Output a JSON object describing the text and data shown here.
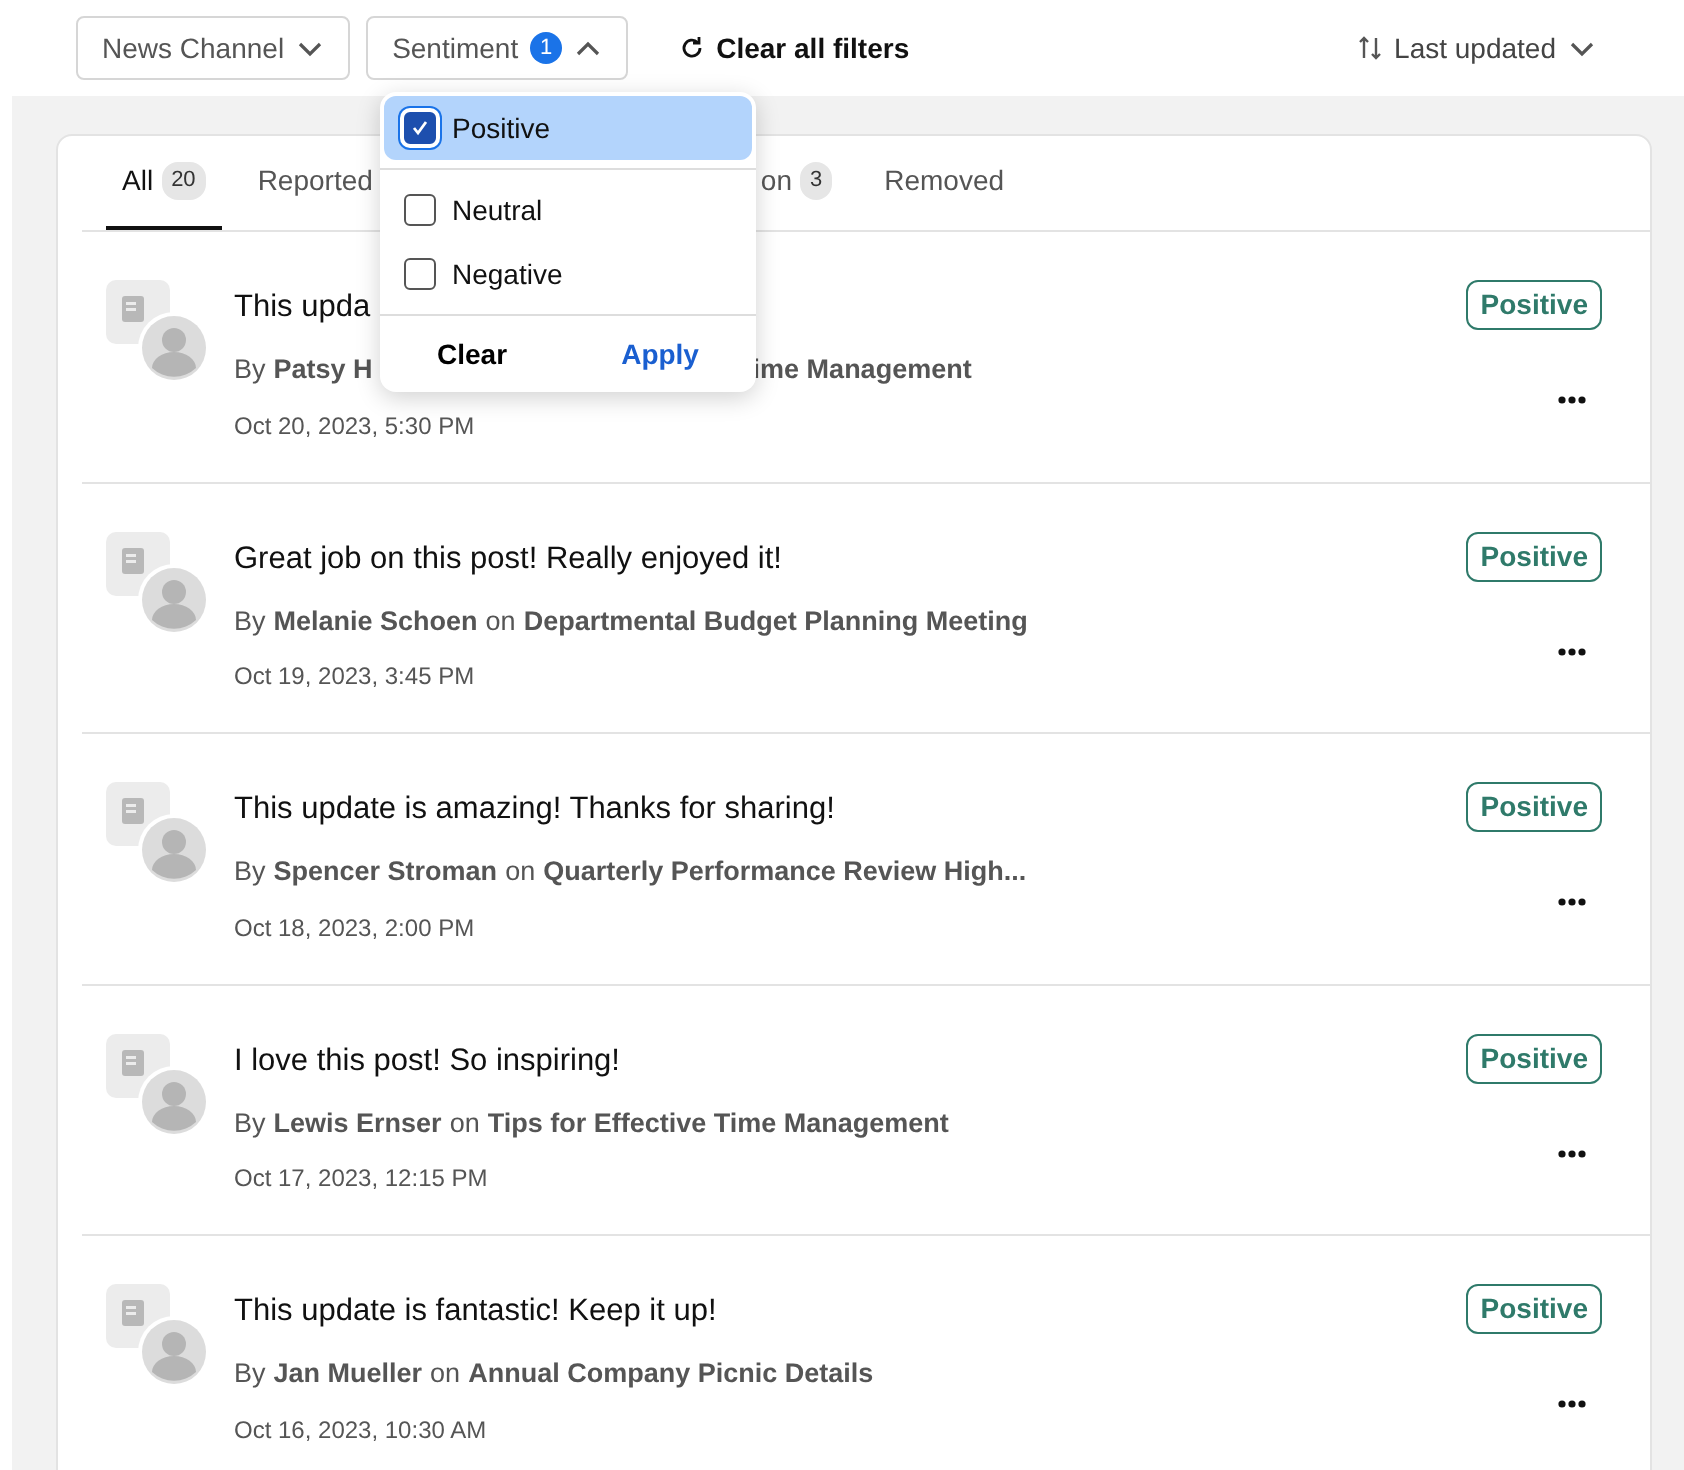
{
  "filters": [
    {
      "label": "News Channel",
      "expanded": false
    },
    {
      "label": "Sentiment",
      "count": "1",
      "expanded": true
    }
  ],
  "clear_filters": "Clear all filters",
  "sort": {
    "label": "Last updated"
  },
  "tabs": [
    {
      "label": "All",
      "count": "20",
      "selected": true
    },
    {
      "label": "Reported",
      "selected": false
    },
    {
      "label": "on",
      "count": "3",
      "selected": false,
      "covered": true
    },
    {
      "label": "Removed",
      "selected": false
    }
  ],
  "dropdown": {
    "options": [
      {
        "label": "Positive",
        "checked": true
      },
      {
        "label": "Neutral",
        "checked": false
      },
      {
        "label": "Negative",
        "checked": false
      }
    ],
    "clear": "Clear",
    "apply": "Apply"
  },
  "comments": [
    {
      "text": "This upda",
      "by": "By",
      "author": "Patsy H",
      "post": "ime Management",
      "date": "Oct 20, 2023, 5:30 PM",
      "sentiment": "Positive",
      "covered": true
    },
    {
      "text": "Great job on this post! Really enjoyed it!",
      "by": "By",
      "author": "Melanie Schoen",
      "on": "on",
      "post": "Departmental Budget Planning Meeting",
      "date": "Oct 19, 2023, 3:45 PM",
      "sentiment": "Positive"
    },
    {
      "text": "This update is amazing! Thanks for sharing!",
      "by": "By",
      "author": "Spencer Stroman",
      "on": "on",
      "post": "Quarterly Performance Review High...",
      "date": "Oct 18, 2023, 2:00 PM",
      "sentiment": "Positive"
    },
    {
      "text": "I love this post! So inspiring!",
      "by": "By",
      "author": "Lewis Ernser",
      "on": "on",
      "post": "Tips for Effective Time Management",
      "date": "Oct 17, 2023, 12:15 PM",
      "sentiment": "Positive"
    },
    {
      "text": "This update is fantastic! Keep it up!",
      "by": "By",
      "author": "Jan Mueller",
      "on": "on",
      "post": "Annual Company Picnic Details",
      "date": "Oct 16, 2023, 10:30 AM",
      "sentiment": "Positive"
    }
  ]
}
